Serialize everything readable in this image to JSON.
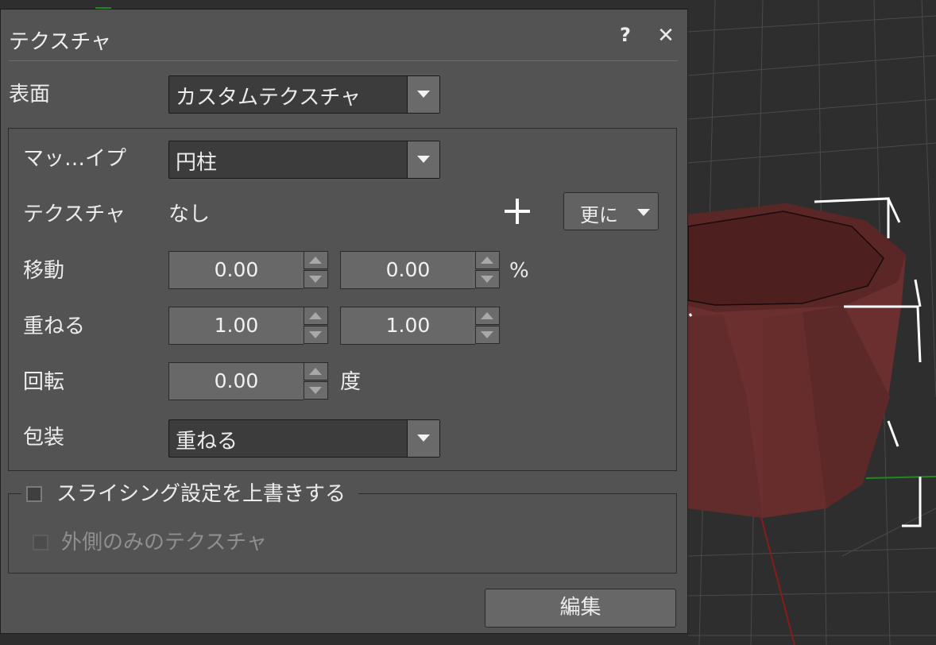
{
  "dialog": {
    "title": "テクスチャ",
    "help_label": "?",
    "close_label": "✕"
  },
  "surface": {
    "label": "表面",
    "value": "カスタムテクスチャ"
  },
  "mapping": {
    "label": "マッ…イプ",
    "value": "円柱"
  },
  "texture": {
    "label": "テクスチャ",
    "value": "なし",
    "more_label": "更に"
  },
  "move": {
    "label": "移動",
    "x": "0.00",
    "y": "0.00",
    "unit": "%"
  },
  "repeat": {
    "label": "重ねる",
    "x": "1.00",
    "y": "1.00"
  },
  "rotation": {
    "label": "回転",
    "value": "0.00",
    "unit": "度"
  },
  "wrap": {
    "label": "包装",
    "value": "重ねる"
  },
  "slicing": {
    "override_label": "スライシング設定を上書きする",
    "override_checked": false,
    "outer_only_label": "外側のみのテクスチャ",
    "outer_only_checked": false,
    "outer_only_enabled": false
  },
  "edit_label": "編集",
  "colors": {
    "dialog_bg": "#535353",
    "viewport_bg": "#2e2e2e",
    "model_color": "#6a2f2f",
    "selection_box": "#ffffff",
    "axis_red": "#8b1a1a",
    "axis_green": "#1a8b1a"
  }
}
